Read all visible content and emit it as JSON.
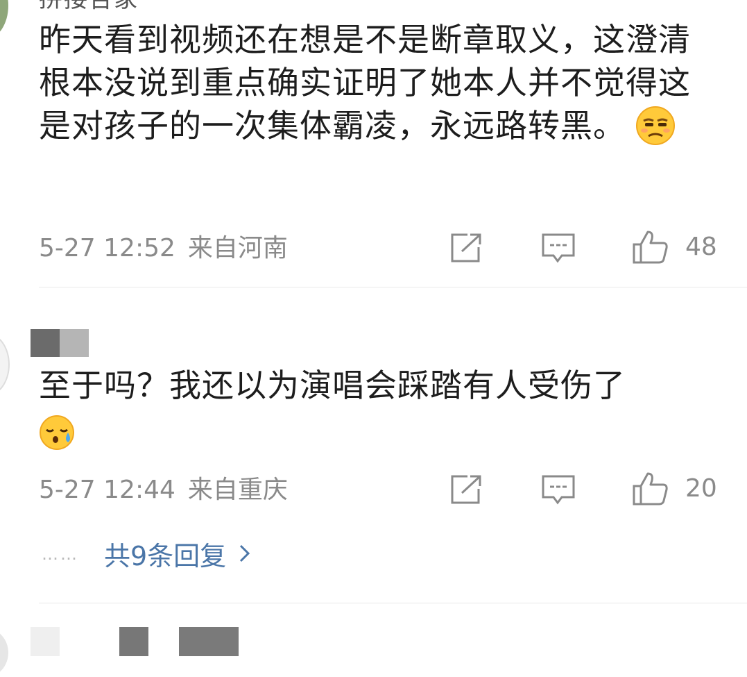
{
  "comments": [
    {
      "username": "拼接告家",
      "text": "昨天看到视频还在想是不是断章取义，这澄清根本没说到重点确实证明了她本人并不觉得这是对孩子的一次集体霸凌，永远路转黑。",
      "emoji": "unamused-face-emoji",
      "time": "5-27 12:52",
      "location": "来自河南",
      "likes": "48"
    },
    {
      "username_blurred": true,
      "text": "至于吗？我还以为演唱会踩踏有人受伤了",
      "emoji": "sad-relieved-face-emoji",
      "time": "5-27 12:44",
      "location": "来自重庆",
      "likes": "20",
      "replies_dots": "……",
      "replies_label": "共9条回复"
    }
  ],
  "icons": {
    "share": "share-icon",
    "comment": "comment-icon",
    "like": "thumbs-up-icon",
    "chevron": "chevron-right-icon"
  },
  "colors": {
    "meta_gray": "#8a8a8a",
    "link_blue": "#4b76a8",
    "divider": "#e9e9e9"
  }
}
